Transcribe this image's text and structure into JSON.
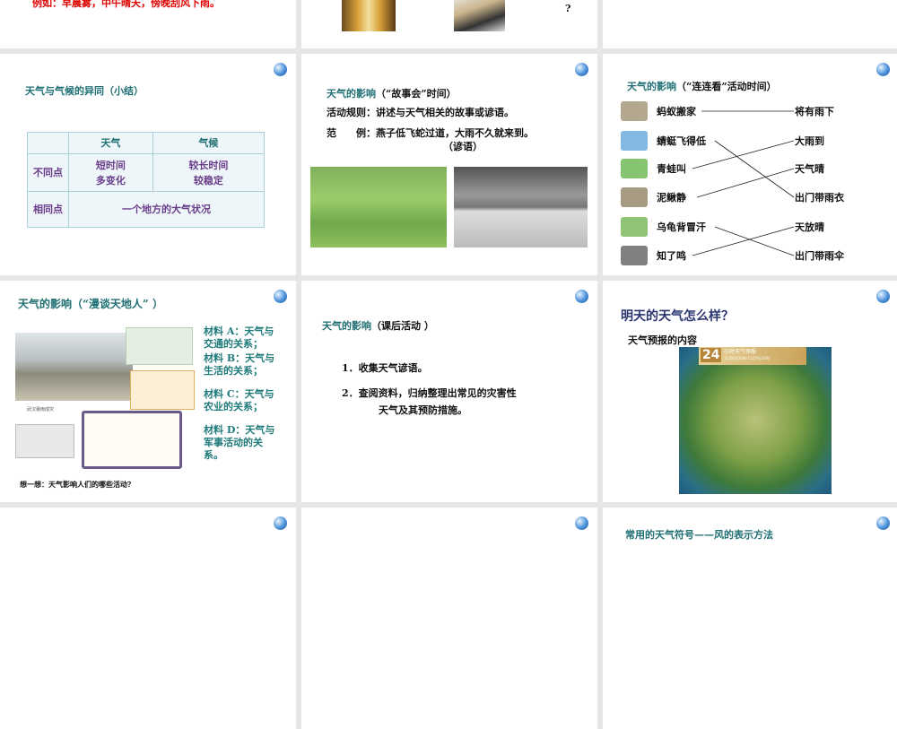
{
  "slides": {
    "s1": {
      "text": "例如：早晨雾，中午晴天，傍晚刮风下雨。",
      "color": "#e00000"
    },
    "s2": {
      "mark": "?"
    },
    "s4": {
      "title": "天气与气候的异同（小结）",
      "table": {
        "headers": [
          "",
          "天气",
          "气候"
        ],
        "row1": {
          "label": "不同点",
          "weather": [
            "短时间",
            "多变化"
          ],
          "climate": [
            "较长时间",
            "较稳定"
          ]
        },
        "row2": {
          "label": "相同点",
          "value": "一个地方的大气状况"
        }
      }
    },
    "s5": {
      "title_a": "天气的影响",
      "title_b": "（“故事会”时间）",
      "rule": "活动规则：讲述与天气相关的故事或谚语。",
      "example": "范　　例：燕子低飞蛇过道，大雨不久就来到。",
      "example_note": "（谚语）"
    },
    "s6": {
      "title_a": "天气的影响",
      "title_b": "（“连连看”活动时间）",
      "left": [
        "蚂蚁搬家",
        "蜻蜓飞得低",
        "青蛙叫",
        "泥鳅静",
        "乌龟背冒汗",
        "知了鸣"
      ],
      "right": [
        "将有雨下",
        "大雨到",
        "天气晴",
        "出门带雨衣",
        "天放晴",
        "出门带雨伞"
      ],
      "pairs": [
        [
          0,
          0
        ],
        [
          1,
          3
        ],
        [
          2,
          1
        ],
        [
          3,
          2
        ],
        [
          4,
          5
        ],
        [
          5,
          4
        ]
      ]
    },
    "s7": {
      "title": "天气的影响（“漫谈天地人” ）",
      "materials": [
        "材料 A：天气与交通的关系；",
        "材料 B：天气与生活的关系；",
        "材料 C：天气与农业的关系；",
        "材料 D：天气与军事活动的关系。"
      ],
      "caption": "武汉暴雨成灾",
      "question": "想一想：天气影响人们的哪些活动？"
    },
    "s8": {
      "title_a": "天气的影响",
      "title_b": "（课后活动 ）",
      "items": [
        "1．收集天气谚语。",
        "2．查阅资料，归纳整理出常见的灾害性",
        "天气及其预防措施。"
      ]
    },
    "s9": {
      "title": "明天的天气怎么样？",
      "subtitle": "天气预报的内容",
      "map_num": "24",
      "map_title": "小时天气预报",
      "map_date": "11月8日20时-11月9日20时"
    },
    "s12": {
      "title": "常用的天气符号——风的表示方法"
    }
  }
}
